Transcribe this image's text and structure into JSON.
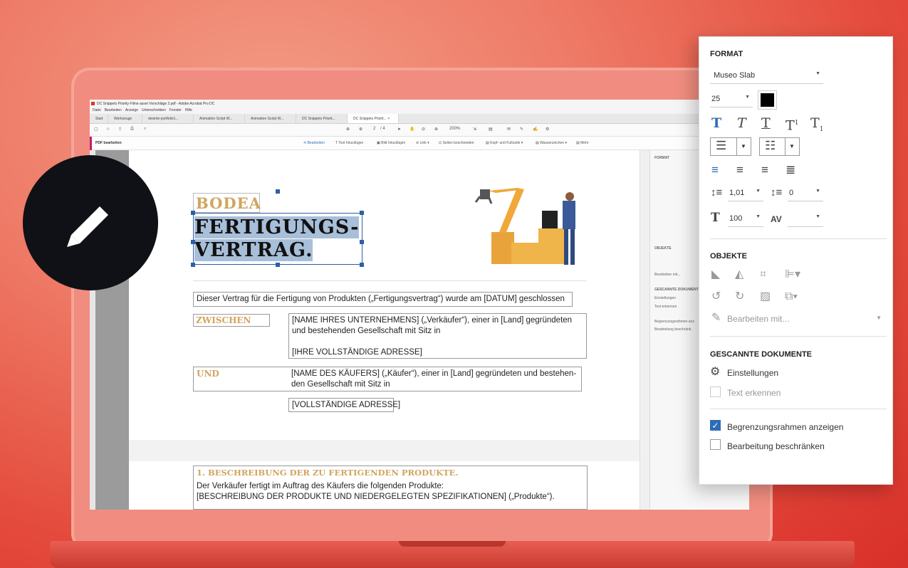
{
  "window": {
    "title": "DC Snippets Priority Filme asset Vorschläge 2.pdf - Adobe Acrobat Pro DC",
    "menu": [
      "Datei",
      "Bearbeiten",
      "Anzeige",
      "Unterschreiben",
      "Fenster",
      "Hilfe"
    ]
  },
  "tabs": [
    "Start",
    "Werkzeuge",
    "desinte-portfolio1...",
    "Animation Script W...",
    "Animation Script W...",
    "DC Snippets Priorit...",
    "DC Snippets Priorit..."
  ],
  "toolbar": {
    "page_current": "2",
    "page_total": "/ 4",
    "zoom": "200%"
  },
  "edit_toolbar": {
    "label": "PDF bearbeiten",
    "items": [
      "Bearbeiten",
      "Text hinzufügen",
      "Bild hinzufügen",
      "Link",
      "Seiten beschneiden",
      "Kopf- und Fußzeile",
      "Wasserzeichen",
      "Mehr"
    ]
  },
  "document": {
    "brand": "BODEA",
    "title_line1": "FERTIGUNGS-",
    "title_line2": "VERTRAG.",
    "intro": "Dieser Vertrag für die Fertigung von Produkten („Fertigungsvertrag“) wurde am [DATUM] geschlossen",
    "between_label": "ZWISCHEN",
    "between_text1": "[NAME IHRES UNTERNEHMENS] („Verkäufer“), einer in [Land] gegründeten und bestehenden Gesellschaft mit Sitz in",
    "between_text2": "[IHRE VOLLSTÄNDIGE ADRESSE]",
    "and_label": "UND",
    "and_text": "[NAME DES KÄUFERS] („Käufer“), einer in [Land] gegründeten und bestehen-den Gesellschaft mit Sitz in",
    "and_address": "[VOLLSTÄNDIGE ADRESSE]",
    "section1_title": "1. BESCHREIBUNG DER ZU FERTIGENDEN PRODUKTE.",
    "section1_line1": "Der Verkäufer fertigt im Auftrag des Käufers die folgenden Produkte:",
    "section1_line2": "[BESCHREIBUNG DER PRODUKTE UND NIEDERGELEGTEN SPEZIFIKATIONEN] („Produkte“)."
  },
  "mini_panel": {
    "format": "FORMAT",
    "objekte": "OBJEKTE",
    "bearbeiten_mit": "Bearbeiten mit...",
    "gescannte": "GESCANNTE DOKUMENTE",
    "einstellungen": "Einstellungen",
    "text_erkennen": "Text erkennen",
    "begrenzung": "Begrenzungsrahmen anz.",
    "beschraenken": "Bearbeitung beschränk."
  },
  "format_panel": {
    "format_heading": "FORMAT",
    "font": "Museo Slab",
    "font_size": "25",
    "text_color": "#000000",
    "line_spacing": "1,01",
    "paragraph_spacing": "0",
    "horizontal_scale": "100",
    "objects_heading": "OBJEKTE",
    "edit_with": "Bearbeiten mit...",
    "scanned_heading": "GESCANNTE DOKUMENTE",
    "settings": "Einstellungen",
    "recognize_text": "Text erkennen",
    "show_bounding_boxes": "Begrenzungsrahmen anzeigen",
    "show_bounding_boxes_checked": true,
    "restrict_editing": "Bearbeitung beschränken",
    "restrict_editing_checked": false
  },
  "colors": {
    "accent": "#2d6db5",
    "gold": "#d1a55f",
    "selection": "#a8bfd9",
    "background": "#e44a3b"
  }
}
